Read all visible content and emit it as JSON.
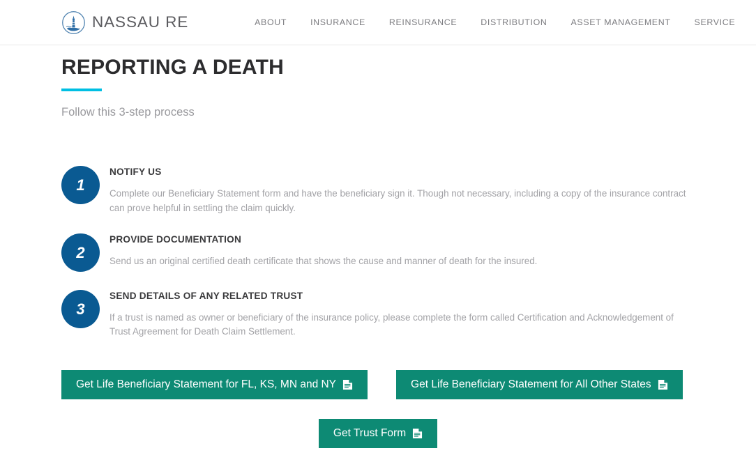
{
  "header": {
    "brand": {
      "name": "NASSAU RE",
      "logo_icon": "lighthouse-circle-icon",
      "logo_color": "#2e6ea6"
    },
    "nav": [
      {
        "label": "ABOUT"
      },
      {
        "label": "INSURANCE"
      },
      {
        "label": "REINSURANCE"
      },
      {
        "label": "DISTRIBUTION"
      },
      {
        "label": "ASSET MANAGEMENT"
      },
      {
        "label": "SERVICE"
      }
    ],
    "search_icon": "search-icon"
  },
  "page": {
    "title": "REPORTING A DEATH",
    "accent_color": "#00bfe3",
    "subtitle": "Follow this 3-step process"
  },
  "steps": [
    {
      "number": "1",
      "title": "NOTIFY US",
      "text": "Complete our Beneficiary Statement form and have the beneficiary sign it. Though not necessary, including a copy of the insurance contract can prove helpful in settling the claim quickly."
    },
    {
      "number": "2",
      "title": "PROVIDE DOCUMENTATION",
      "text": "Send us an original certified death certificate that shows the cause and manner of death for the insured."
    },
    {
      "number": "3",
      "title": "SEND DETAILS OF ANY RELATED TRUST",
      "text": "If a trust is named as owner or beneficiary of the insurance policy, please complete the form called Certification and Acknowledgement of Trust Agreement for Death Claim Settlement."
    }
  ],
  "buttons": {
    "color": "#0d8a74",
    "icon": "document-file-icon",
    "beneficiary_select_states": "Get Life Beneficiary Statement for FL, KS, MN and NY",
    "beneficiary_all_states": "Get Life Beneficiary Statement for All Other States",
    "trust_form": "Get Trust Form"
  },
  "colors": {
    "step_badge": "#0a5a92",
    "title_text": "#2c2c2e",
    "body_text": "#a2a2a6"
  }
}
